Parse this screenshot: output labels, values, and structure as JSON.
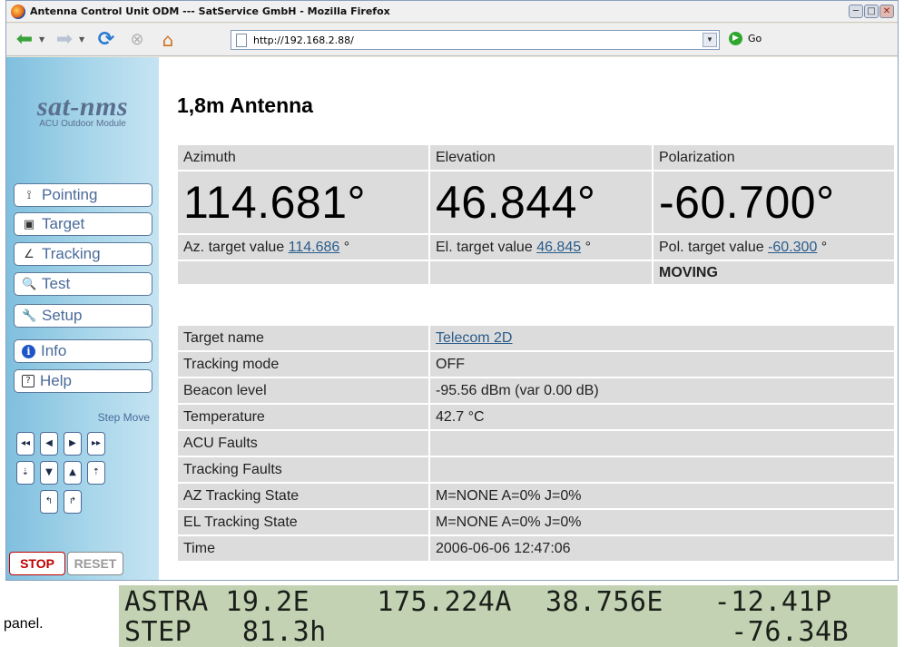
{
  "window": {
    "title": "Antenna Control Unit ODM --- SatService GmbH - Mozilla Firefox",
    "buttons": {
      "minimize": "─",
      "maximize": "□",
      "close": "✕"
    }
  },
  "navbar": {
    "url": "http://192.168.2.88/",
    "go_label": "Go"
  },
  "sidebar": {
    "logo": "sat-nms",
    "logo_sub": "ACU Outdoor Module",
    "menu": [
      {
        "label": "Pointing",
        "icon": "pointing-icon",
        "glyph": "⟟"
      },
      {
        "label": "Target",
        "icon": "target-icon",
        "glyph": "▣"
      },
      {
        "label": "Tracking",
        "icon": "tracking-icon",
        "glyph": "∠"
      },
      {
        "label": "Test",
        "icon": "magnifier-icon",
        "glyph": "🔍"
      },
      {
        "label": "Setup",
        "icon": "wrench-icon",
        "glyph": "🔧"
      },
      {
        "label": "Info",
        "icon": "info-icon",
        "glyph": "i"
      },
      {
        "label": "Help",
        "icon": "help-icon",
        "glyph": "?"
      }
    ],
    "step_move_label": "Step Move",
    "step_buttons": {
      "az_fast_left": "◂◂",
      "az_left": "◀",
      "az_right": "▶",
      "az_fast_right": "▸▸",
      "el_fast_down": "⇣",
      "el_down": "▼",
      "el_up": "▲",
      "el_fast_up": "⇡",
      "pol_ccw": "↰",
      "pol_cw": "↱"
    },
    "stop_label": "STOP",
    "reset_label": "RESET"
  },
  "main": {
    "title": "1,8m Antenna",
    "position": {
      "azimuth": {
        "header": "Azimuth",
        "value": "114.681°",
        "target_prefix": "Az. target value",
        "target_value": "114.686",
        "target_unit": "°"
      },
      "elevation": {
        "header": "Elevation",
        "value": "46.844°",
        "target_prefix": "El. target value",
        "target_value": "46.845",
        "target_unit": "°"
      },
      "polarization": {
        "header": "Polarization",
        "value": "-60.700°",
        "target_prefix": "Pol. target value",
        "target_value": "-60.300",
        "target_unit": "°",
        "status": "MOVING"
      }
    },
    "info": [
      {
        "label": "Target name",
        "value": "Telecom 2D",
        "link": true
      },
      {
        "label": "Tracking mode",
        "value": "OFF"
      },
      {
        "label": "Beacon level",
        "value": "-95.56 dBm (var 0.00 dB)"
      },
      {
        "label": "Temperature",
        "value": "42.7 °C"
      },
      {
        "label": "ACU Faults",
        "value": ""
      },
      {
        "label": "Tracking Faults",
        "value": ""
      },
      {
        "label": "AZ Tracking State",
        "value": "M=NONE A=0% J=0%"
      },
      {
        "label": "EL Tracking State",
        "value": "M=NONE A=0% J=0%"
      },
      {
        "label": "Time",
        "value": "2006-06-06 12:47:06"
      }
    ]
  },
  "panel": {
    "caption": "panel.",
    "line1": "ASTRA 19.2E    175.224A  38.756E   -12.41P",
    "line2": "STEP   81.3h                        -76.34B"
  },
  "colors": {
    "sidebar_gradient_start": "#7fbfde",
    "menu_text": "#4a6a9a",
    "link": "#2a5c8a",
    "status_moving": "#1a9a1a",
    "stop": "#c00000",
    "lcd_background": "#c3d2b2"
  }
}
